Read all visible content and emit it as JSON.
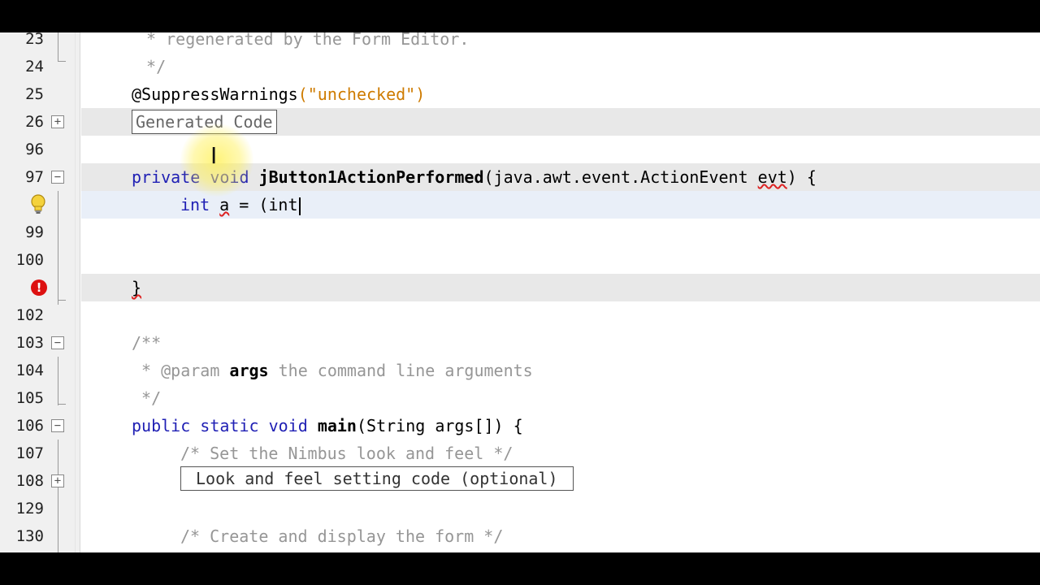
{
  "lines": {
    "l23": {
      "num": "23",
      "text": " * regenerated by the Form Editor."
    },
    "l24": {
      "num": "24",
      "text": " */"
    },
    "l25": {
      "num": "25",
      "annotation": "@SuppressWarnings",
      "arg": "(\"unchecked\")"
    },
    "l26": {
      "num": "26",
      "fold_label": "Generated Code"
    },
    "l96": {
      "num": "96"
    },
    "l97": {
      "num": "97",
      "kw1": "private",
      "kw2": "void",
      "method": "jButton1ActionPerformed",
      "params_pre": "(java.awt.event.ActionEvent ",
      "param_name": "evt",
      "params_post": ") {"
    },
    "l98": {
      "kw": "int",
      "var": "a",
      "rest": " = (int"
    },
    "l99": {
      "num": "99"
    },
    "l100": {
      "num": "100"
    },
    "l101": {
      "brace": "}"
    },
    "l102": {
      "num": "102"
    },
    "l103": {
      "num": "103",
      "text": "/**"
    },
    "l104": {
      "num": "104",
      "star": " * ",
      "tag": "@param",
      "name": "args",
      "text": " the command line arguments"
    },
    "l105": {
      "num": "105",
      "text": " */"
    },
    "l106": {
      "num": "106",
      "kw1": "public",
      "kw2": "static",
      "kw3": "void",
      "method": "main",
      "rest": "(String args[]) {"
    },
    "l107": {
      "num": "107",
      "text": "/* Set the Nimbus look and feel */"
    },
    "l108": {
      "num": "108",
      "fold_label": "Look and feel setting code (optional)"
    },
    "l129": {
      "num": "129"
    },
    "l130": {
      "num": "130",
      "text": "/* Create and display the form */"
    }
  },
  "icons": {
    "hint": "lightbulb-icon",
    "error": "error-icon",
    "expand": "plus-icon",
    "collapse": "minus-icon"
  }
}
